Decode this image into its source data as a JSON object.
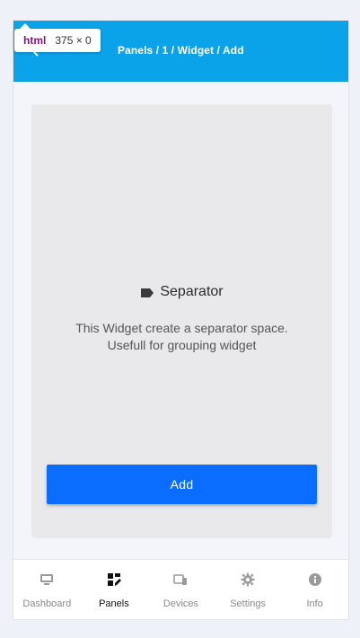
{
  "devtools_tooltip": {
    "tag": "html",
    "size": "375 × 0"
  },
  "header": {
    "breadcrumb": "Panels / 1 / Widget / Add"
  },
  "widget": {
    "title": "Separator",
    "description_line1": "This Widget create a separator space.",
    "description_line2": "Usefull for grouping widget",
    "add_label": "Add"
  },
  "bottom_nav": {
    "items": [
      {
        "label": "Dashboard",
        "icon": "monitor-icon",
        "active": false
      },
      {
        "label": "Panels",
        "icon": "panels-icon",
        "active": true
      },
      {
        "label": "Devices",
        "icon": "devices-icon",
        "active": false
      },
      {
        "label": "Settings",
        "icon": "gear-icon",
        "active": false
      },
      {
        "label": "Info",
        "icon": "info-icon",
        "active": false
      }
    ]
  },
  "colors": {
    "header_bg": "#0aa3ea",
    "button_bg": "#0b6dfd",
    "card_bg": "#e9e9eb",
    "nav_active": "#111111",
    "nav_inactive": "#8a8a8a"
  }
}
